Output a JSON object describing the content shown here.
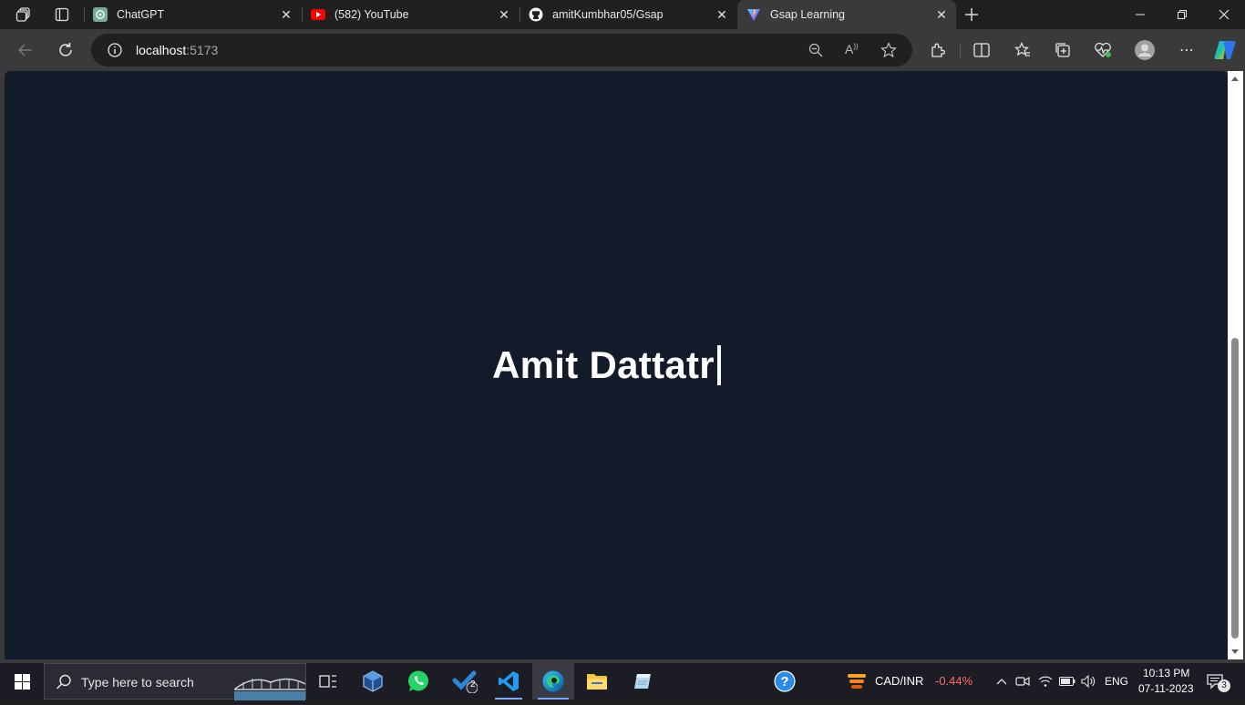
{
  "browser": {
    "tabs": [
      {
        "title": "ChatGPT",
        "icon": "chatgpt-icon"
      },
      {
        "title": "(582) YouTube",
        "icon": "youtube-icon"
      },
      {
        "title": "amitKumbhar05/Gsap",
        "icon": "github-icon"
      },
      {
        "title": "Gsap Learning",
        "icon": "vite-icon",
        "active": true
      }
    ],
    "address": {
      "host": "localhost",
      "port": ":5173"
    }
  },
  "page": {
    "headline": "Amit Dattatr",
    "background": "#131a29"
  },
  "taskbar": {
    "search_placeholder": "Type here to search",
    "todo_badge": "2",
    "currency": {
      "pair": "CAD/INR",
      "change": "-0.44%",
      "change_color": "#ff6b6b"
    },
    "language": "ENG",
    "time": "10:13 PM",
    "date": "07-11-2023",
    "notifications": "3"
  }
}
